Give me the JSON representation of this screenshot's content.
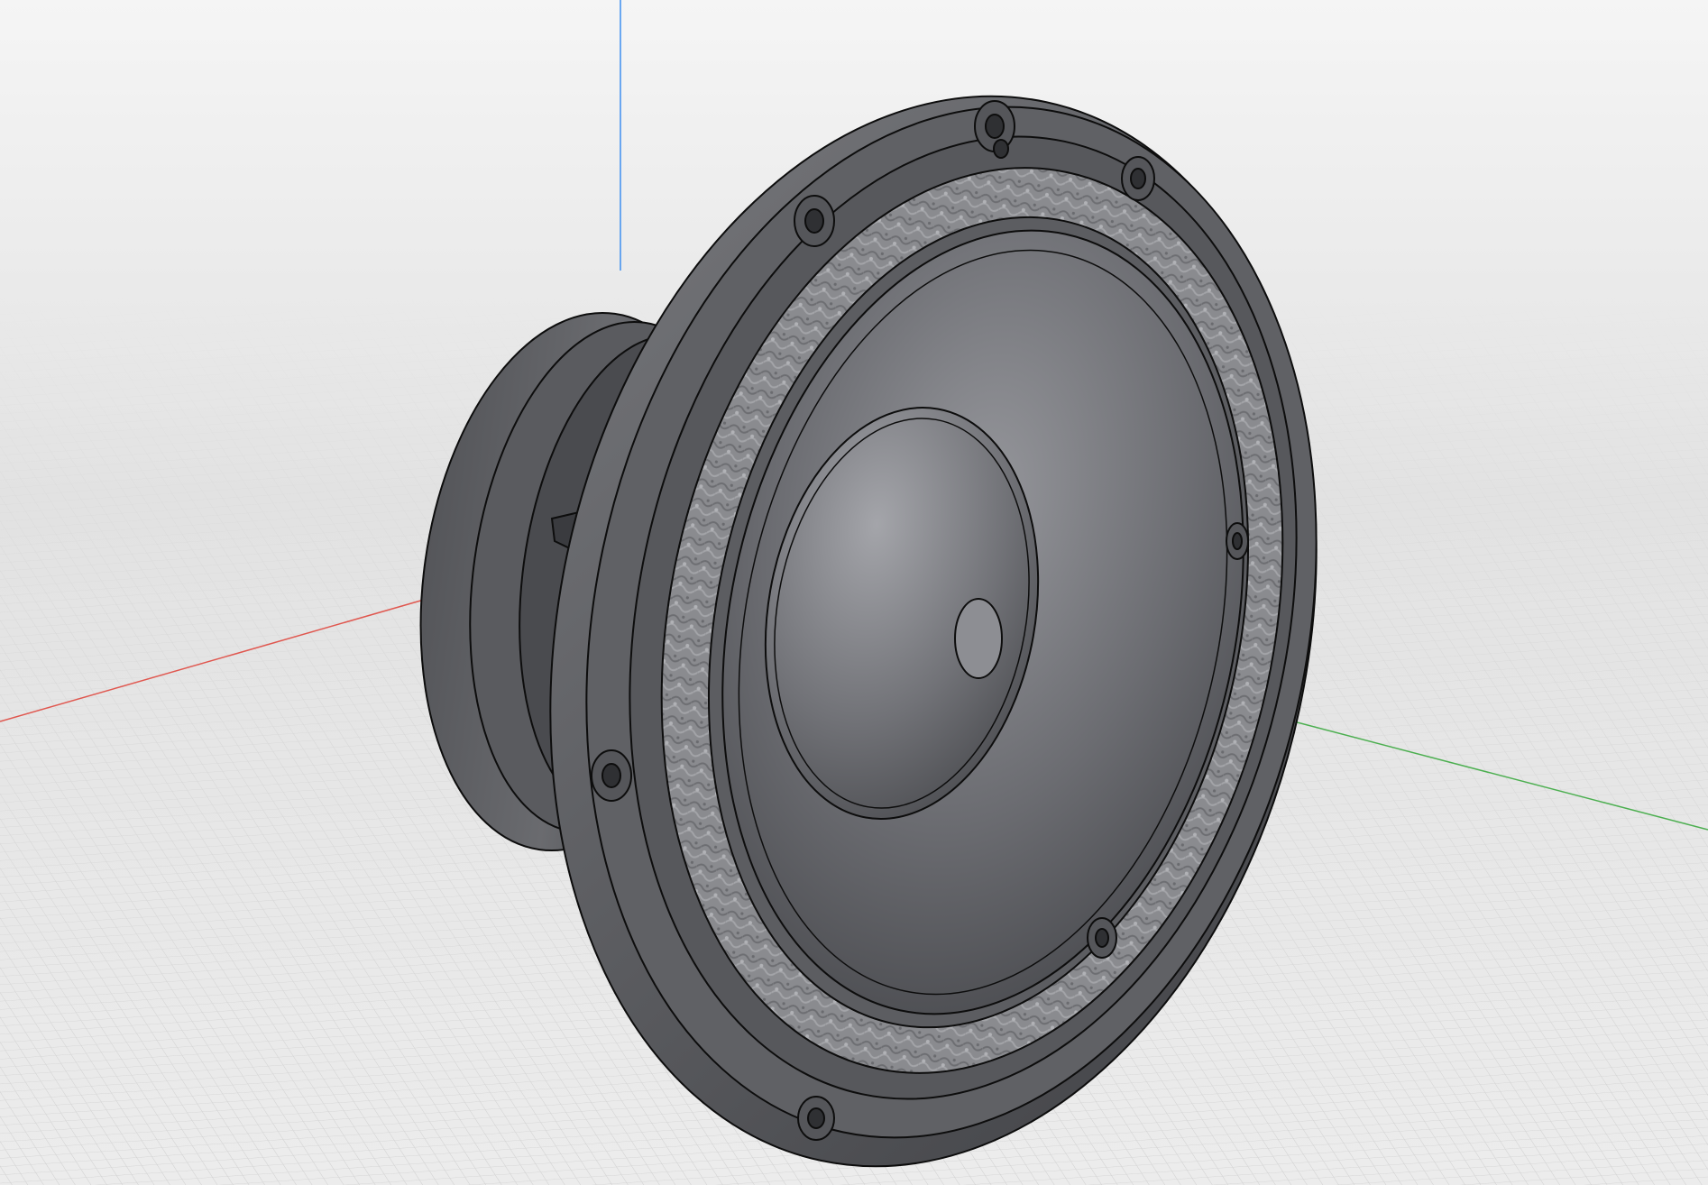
{
  "viewport": {
    "background_top": "#f4f4f4",
    "background_horizon": "#e4e4e4",
    "background_bottom": "#ececec",
    "grid_color": "#c9c9c9",
    "axis_x_color": "#e0574f",
    "axis_y_color": "#4caf50",
    "axis_z_color": "#3d8ef0"
  },
  "model": {
    "name": "speaker-driver",
    "body_color": "#5e5f63",
    "edge_color": "#0d0d0d",
    "surround_color": "#8a8b8f",
    "cone_color": "#6a6b70",
    "dust_cap_color": "#8d8e93",
    "mounting_hole_icon": "screw-hole-icon",
    "mounting_hole_count": 8
  }
}
